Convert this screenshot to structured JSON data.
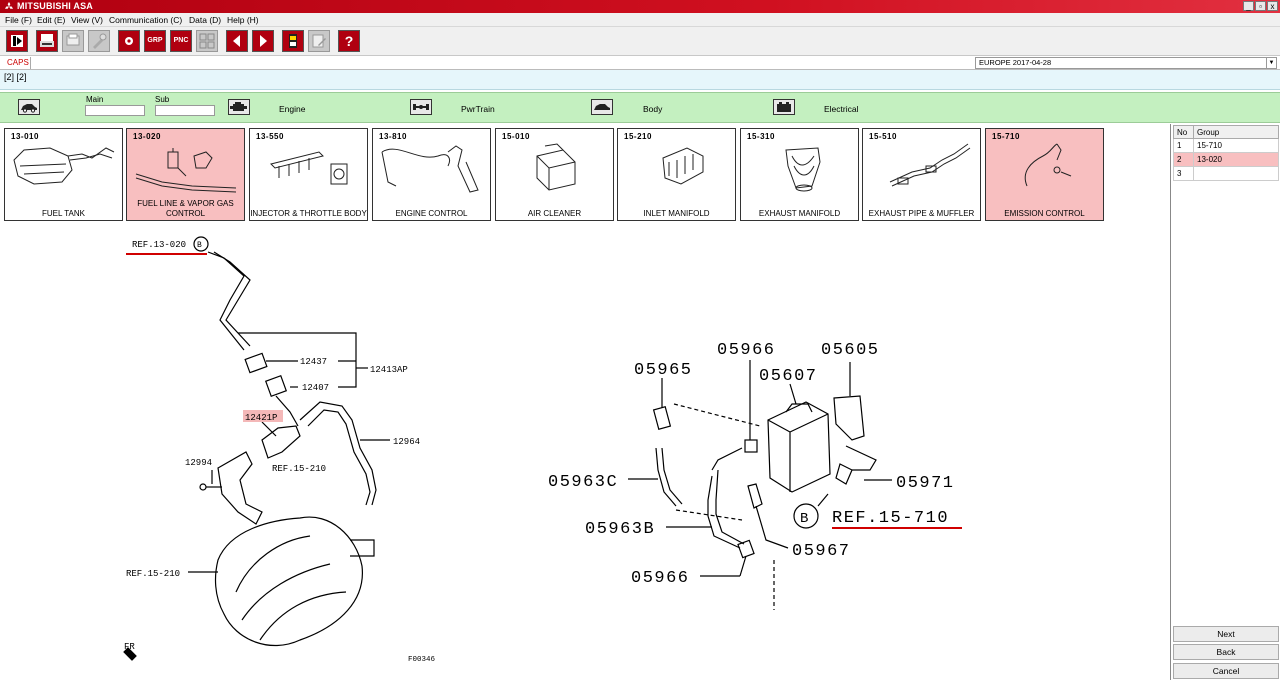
{
  "window": {
    "title": "MITSUBISHI ASA",
    "controls": [
      "_",
      "▫",
      "x"
    ]
  },
  "menu": [
    "File (F)",
    "Edit (E)",
    "View (V)",
    "Communication (C)",
    "Data (D)",
    "Help (H)"
  ],
  "toolbar": {
    "grp_label": "GRP",
    "pnc_label": "PNC",
    "help_label": "?"
  },
  "info": {
    "caps": "CAPS",
    "region": "EUROPE   2017-04-28",
    "path": "[2] [2]"
  },
  "category_bar": {
    "main_label": "Main",
    "sub_label": "Sub",
    "engine": "Engine",
    "pwrtrain": "PwrTrain",
    "body": "Body",
    "electrical": "Electrical"
  },
  "groups": [
    {
      "code": "13-010",
      "label": "FUEL TANK",
      "selected": false
    },
    {
      "code": "13-020",
      "label": "FUEL LINE & VAPOR GAS CONTROL",
      "selected": true
    },
    {
      "code": "13-550",
      "label": "INJECTOR & THROTTLE BODY",
      "selected": false
    },
    {
      "code": "13-810",
      "label": "ENGINE CONTROL",
      "selected": false
    },
    {
      "code": "15-010",
      "label": "AIR CLEANER",
      "selected": false
    },
    {
      "code": "15-210",
      "label": "INLET MANIFOLD",
      "selected": false
    },
    {
      "code": "15-310",
      "label": "EXHAUST MANIFOLD",
      "selected": false
    },
    {
      "code": "15-510",
      "label": "EXHAUST PIPE & MUFFLER",
      "selected": false
    },
    {
      "code": "15-710",
      "label": "EMISSION CONTROL",
      "selected": true
    }
  ],
  "history": {
    "headers": [
      "No",
      "Group"
    ],
    "rows": [
      {
        "no": "1",
        "group": "15-710",
        "selected": false
      },
      {
        "no": "2",
        "group": "13-020",
        "selected": true
      },
      {
        "no": "3",
        "group": "",
        "selected": false
      }
    ]
  },
  "nav": {
    "next": "Next",
    "back": "Back",
    "cancel": "Cancel"
  },
  "diagram": {
    "left": {
      "ref_top": "REF.13-020",
      "ref_top_circle": "B",
      "p12437": "12437",
      "p12407": "12407",
      "p12413ap": "12413AP",
      "p12421p": "12421P",
      "p12964": "12964",
      "p12994": "12994",
      "ref_15210_a": "REF.15-210",
      "ref_15210_b": "REF.15-210",
      "fr": "FR",
      "figure_no": "F00346"
    },
    "right": {
      "p05965": "05965",
      "p05966_top": "05966",
      "p05605": "05605",
      "p05607": "05607",
      "p05963c": "05963C",
      "p05971": "05971",
      "p05963b": "05963B",
      "ref_circle": "B",
      "ref_15710": "REF.15-710",
      "p05967": "05967",
      "p05966_bot": "05966"
    }
  },
  "colors": {
    "title_red": "#c00010",
    "selected_pink": "#f8bfc0",
    "category_green": "#c4f0c0",
    "ref_underline": "#d00000",
    "highlight_part": "#f4b8b8"
  }
}
